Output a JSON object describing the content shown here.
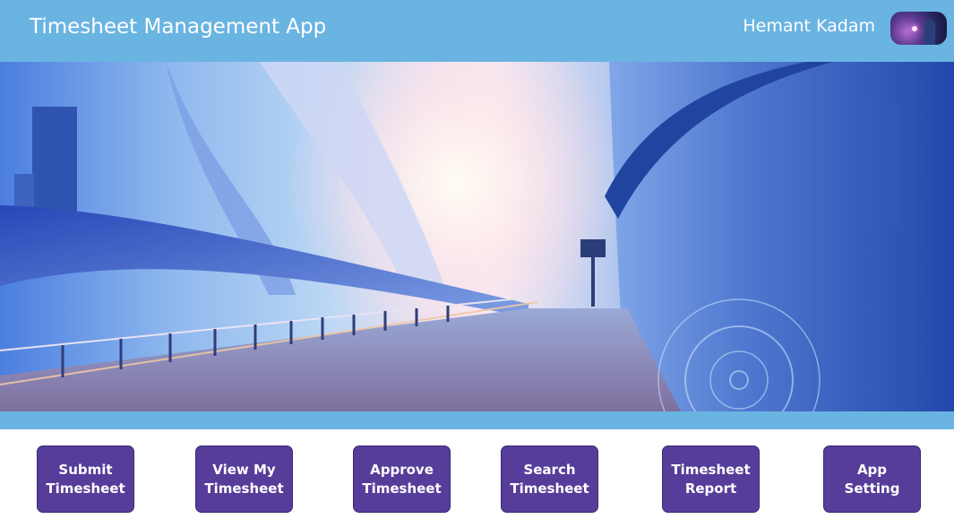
{
  "header": {
    "title": "Timesheet Management App",
    "user_name": "Hemant Kadam"
  },
  "nav": {
    "submit_label": "Submit Timesheet",
    "view_label": "View My Timesheet",
    "approve_label": "Approve Timesheet",
    "search_label": "Search Timesheet",
    "report_label": "Timesheet Report",
    "setting_label": "App Setting"
  },
  "colors": {
    "header_bg": "#6ab4e2",
    "button_bg": "#563d9a",
    "button_text": "#ffffff"
  }
}
